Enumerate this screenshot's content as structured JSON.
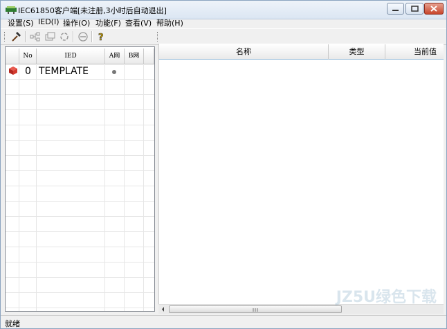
{
  "window": {
    "title": "IEC61850客户端[未注册,3小时后自动退出]",
    "accent": "#dbe6f3"
  },
  "menubar": {
    "items": [
      {
        "label": "设置(S)"
      },
      {
        "label": "IED(I)"
      },
      {
        "label": "操作(O)"
      },
      {
        "label": "功能(F)"
      },
      {
        "label": "查看(V)"
      },
      {
        "label": "帮助(H)"
      }
    ]
  },
  "toolbar": {
    "buttons": [
      {
        "icon": "hammer-icon"
      },
      {
        "icon": "network-icon"
      },
      {
        "icon": "copy-icon"
      },
      {
        "icon": "refresh-icon"
      },
      {
        "icon": "stop-icon"
      },
      {
        "icon": "help-icon"
      }
    ]
  },
  "ied_list": {
    "columns": [
      "No",
      "IED",
      "A网",
      "B网"
    ],
    "rows": [
      {
        "no": "0",
        "ied": "TEMPLATE",
        "a_net": "●",
        "b_net": ""
      }
    ]
  },
  "detail_table": {
    "columns": [
      "名称",
      "类型",
      "当前值"
    ]
  },
  "statusbar": {
    "text": "就绪"
  },
  "watermark": {
    "text": "JZ5U绿色下载"
  }
}
